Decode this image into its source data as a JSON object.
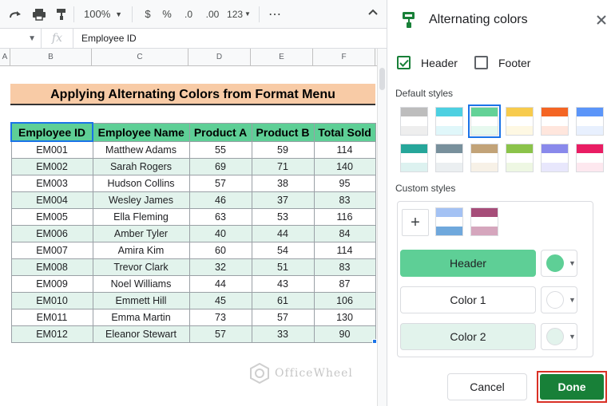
{
  "toolbar": {
    "zoom": "100%",
    "currency": "$",
    "percent": "%",
    "decrease_decimals": ".0",
    "increase_decimals": ".00",
    "more_formats": "123",
    "more": "⋯"
  },
  "formula_bar": {
    "cell_ref": "▼",
    "fx": "fx",
    "value": "Employee ID"
  },
  "columns": [
    "A",
    "B",
    "C",
    "D",
    "E",
    "F"
  ],
  "sheet": {
    "title": "Applying Alternating Colors from Format Menu",
    "headers": [
      "Employee ID",
      "Employee Name",
      "Product A",
      "Product B",
      "Total Sold"
    ],
    "rows": [
      [
        "EM001",
        "Matthew Adams",
        "55",
        "59",
        "114"
      ],
      [
        "EM002",
        "Sarah Rogers",
        "69",
        "71",
        "140"
      ],
      [
        "EM003",
        "Hudson Collins",
        "57",
        "38",
        "95"
      ],
      [
        "EM004",
        "Wesley James",
        "46",
        "37",
        "83"
      ],
      [
        "EM005",
        "Ella Fleming",
        "63",
        "53",
        "116"
      ],
      [
        "EM006",
        "Amber Tyler",
        "40",
        "44",
        "84"
      ],
      [
        "EM007",
        "Amira Kim",
        "60",
        "54",
        "114"
      ],
      [
        "EM008",
        "Trevor Clark",
        "32",
        "51",
        "83"
      ],
      [
        "EM009",
        "Noel Williams",
        "44",
        "43",
        "87"
      ],
      [
        "EM010",
        "Emmett Hill",
        "45",
        "61",
        "106"
      ],
      [
        "EM011",
        "Emma Martin",
        "73",
        "57",
        "130"
      ],
      [
        "EM012",
        "Eleanor Stewart",
        "57",
        "33",
        "90"
      ]
    ]
  },
  "watermark": "OfficeWheel",
  "panel": {
    "title": "Alternating colors",
    "header_checkbox": "Header",
    "footer_checkbox": "Footer",
    "default_styles_label": "Default styles",
    "custom_styles_label": "Custom styles",
    "add_symbol": "+",
    "header_field": "Header",
    "color1_field": "Color 1",
    "color2_field": "Color 2",
    "cancel": "Cancel",
    "done": "Done"
  },
  "colors": {
    "header": "#5ecf96",
    "color1": "#ffffff",
    "color2": "#e2f3ec",
    "title_fill": "#f8cba6",
    "done": "#188038"
  },
  "default_styles": [
    [
      "#bdbdbd",
      "#ffffff",
      "#eeeeee"
    ],
    [
      "#4dd0e1",
      "#ffffff",
      "#e0f7fa"
    ],
    [
      "#63d297",
      "#ffffff",
      "#e7f9ef"
    ],
    [
      "#f7cb4d",
      "#ffffff",
      "#fef8e3"
    ],
    [
      "#f46524",
      "#ffffff",
      "#ffe6dd"
    ],
    [
      "#5b95f9",
      "#ffffff",
      "#e8f0fe"
    ],
    [
      "#26a69a",
      "#ffffff",
      "#ddf2f0"
    ],
    [
      "#78909c",
      "#ffffff",
      "#ebeff1"
    ],
    [
      "#c2a378",
      "#ffffff",
      "#f7f1e7"
    ],
    [
      "#8bc34a",
      "#ffffff",
      "#eef7e3"
    ],
    [
      "#8989eb",
      "#ffffff",
      "#e8e7fc"
    ],
    [
      "#e91d63",
      "#ffffff",
      "#fde8ef"
    ]
  ],
  "custom_styles": [
    [
      "#a4c2f4",
      "#ffffff",
      "#6fa8dc"
    ],
    [
      "#a64d79",
      "#ffffff",
      "#d5a6bd"
    ]
  ]
}
